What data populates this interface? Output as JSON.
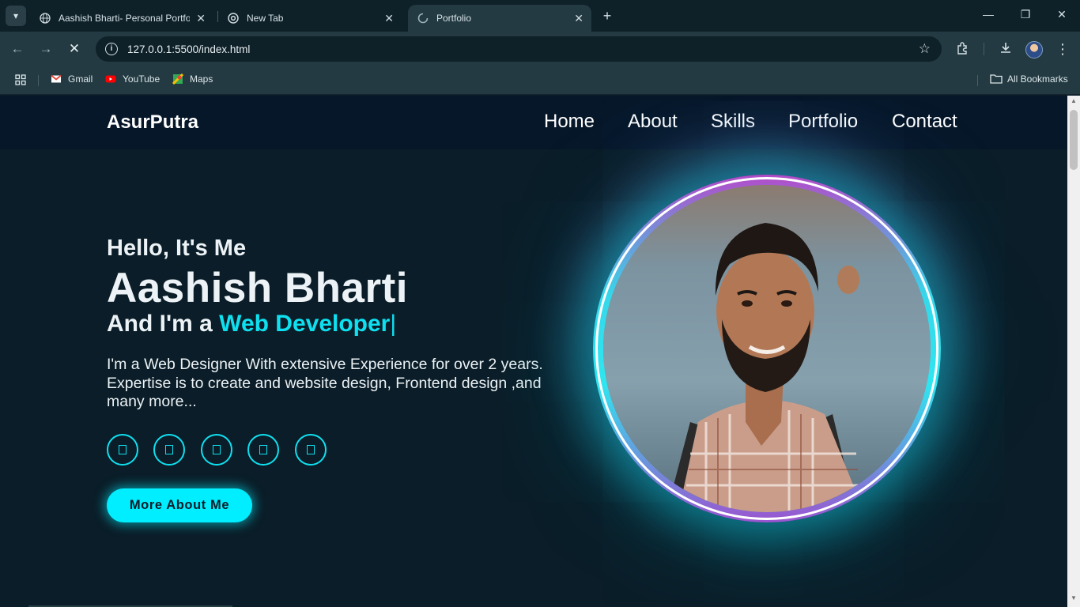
{
  "browser": {
    "tabs": [
      {
        "title": "Aashish Bharti- Personal Portfolio",
        "active": false,
        "icon": "globe-icon"
      },
      {
        "title": "New Tab",
        "active": false,
        "icon": "chrome-icon"
      },
      {
        "title": "Portfolio",
        "active": true,
        "icon": "loading-icon"
      }
    ],
    "url": "127.0.0.1:5500/index.html",
    "bookmarks": [
      {
        "label": "Gmail",
        "icon": "gmail-icon",
        "color": "#ea4335"
      },
      {
        "label": "YouTube",
        "icon": "youtube-icon",
        "color": "#ff0000"
      },
      {
        "label": "Maps",
        "icon": "maps-icon",
        "color": "#34a853"
      }
    ],
    "all_bookmarks": "All Bookmarks"
  },
  "site": {
    "logo": "AsurPutra",
    "nav": [
      "Home",
      "About",
      "Skills",
      "Portfolio",
      "Contact"
    ],
    "hero": {
      "greeting": "Hello, It's Me",
      "name": "Aashish Bharti",
      "role_prefix": "And I'm a",
      "role_accent": "Web Developer",
      "caret": "|",
      "description": "I'm a Web Designer With extensive Experience for over 2 years. Expertise is to create and website design, Frontend design ,and many more...",
      "social_icons": [
        "social-icon-1",
        "social-icon-2",
        "social-icon-3",
        "social-icon-4",
        "social-icon-5"
      ],
      "cta_label": "More About Me"
    }
  },
  "colors": {
    "accent": "#00eeff",
    "page_bg": "#0a1d28",
    "header_bg": "#07172a",
    "chrome_bg": "#233a42"
  }
}
